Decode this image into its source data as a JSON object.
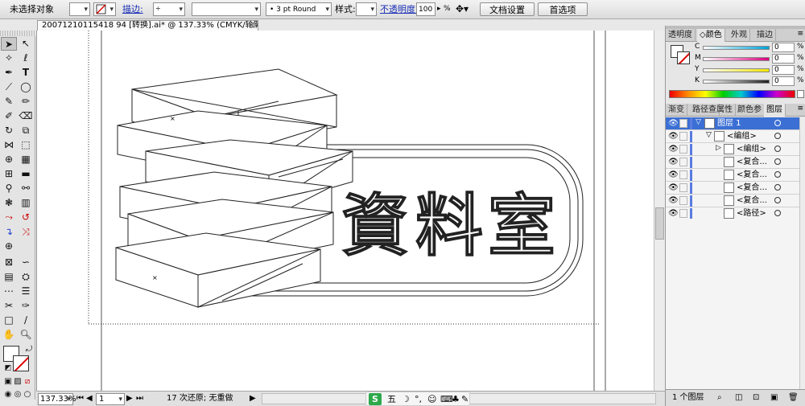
{
  "control_bar": {
    "selection_label": "未选择对象",
    "stroke_link": "描边:",
    "brush_value": "3 pt Round",
    "style_label": "样式:",
    "opacity_link": "不透明度:",
    "opacity_value": "100",
    "opacity_unit": "%",
    "doc_setup_button": "文档设置",
    "prefs_button": "首选项"
  },
  "document": {
    "tab_title": "20071210115418 94 [转换].ai* @ 137.33% (CMYK/轮廓)",
    "close_glyph": "⊠"
  },
  "artwork": {
    "glyph_1": "資",
    "glyph_2": "料",
    "glyph_3": "室"
  },
  "status_bar": {
    "zoom": "137.33%",
    "page": "1",
    "history": "17 次还原; 无重做"
  },
  "taskbar": {
    "ime_badge": "S",
    "ime_mode": "五"
  },
  "color_panel": {
    "tabs": [
      "透明度",
      "颜色",
      "外观",
      "描边"
    ],
    "active_tab_index": 1,
    "channels": [
      {
        "label": "C",
        "value": "0",
        "unit": "%",
        "color": "#00a3d9"
      },
      {
        "label": "M",
        "value": "0",
        "unit": "%",
        "color": "#d9007e"
      },
      {
        "label": "Y",
        "value": "0",
        "unit": "%",
        "color": "#f2e600"
      },
      {
        "label": "K",
        "value": "0",
        "unit": "%",
        "color": "#222222"
      }
    ]
  },
  "layers_panel": {
    "tabs": [
      "渐变",
      "路径查",
      "属性",
      "颜色参",
      "图层"
    ],
    "active_tab_index": 4,
    "items": [
      {
        "name": "图层 1",
        "selected": true,
        "indent": 0
      },
      {
        "name": "<编组>",
        "selected": false,
        "indent": 1
      },
      {
        "name": "<编组>",
        "selected": false,
        "indent": 2
      },
      {
        "name": "<复合...",
        "selected": false,
        "indent": 2
      },
      {
        "name": "<复合...",
        "selected": false,
        "indent": 2
      },
      {
        "name": "<复合...",
        "selected": false,
        "indent": 2
      },
      {
        "name": "<复合...",
        "selected": false,
        "indent": 2
      },
      {
        "name": "<路径>",
        "selected": false,
        "indent": 2
      }
    ],
    "footer_label": "1 个图层"
  },
  "colors": {
    "accent": "#1a2fb6",
    "selection": "#3b6fd4",
    "layer_color": "#5b7be0"
  }
}
